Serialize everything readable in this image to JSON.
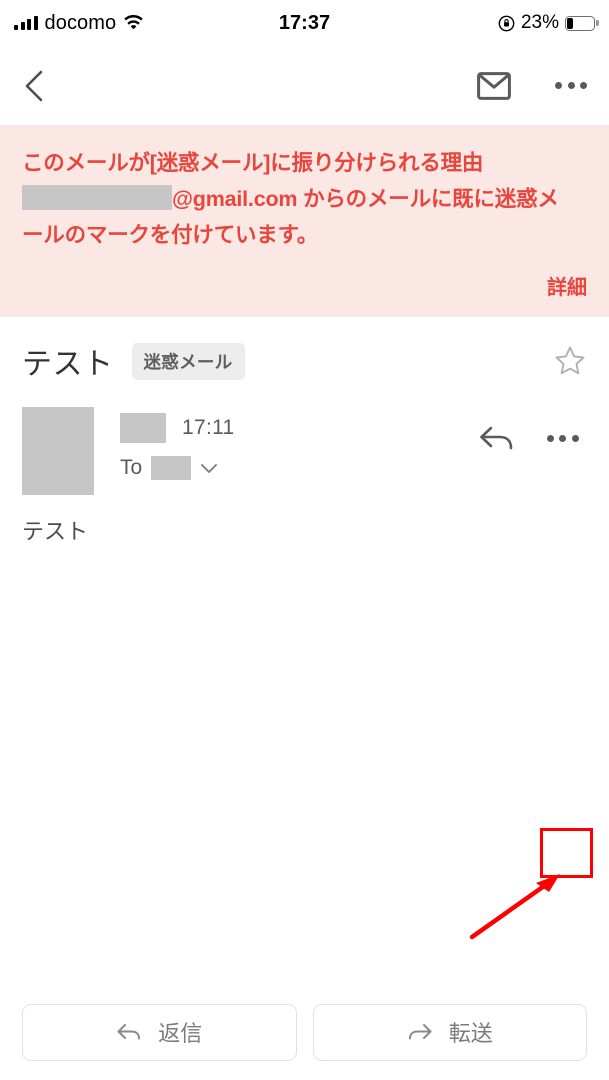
{
  "status_bar": {
    "carrier": "docomo",
    "time": "17:37",
    "battery_percent": "23%",
    "signal_icon": "signal-bars-icon",
    "wifi_icon": "wifi-icon",
    "rotation_lock_icon": "rotation-lock-icon",
    "battery_icon": "battery-icon",
    "battery_level": 23
  },
  "nav_bar": {
    "back_icon": "chevron-left-icon",
    "mail_icon": "envelope-icon",
    "more_icon": "more-horizontal-icon"
  },
  "spam_banner": {
    "title": "このメールが[迷惑メール]に振り分けられる理由",
    "body_part1": "@gmail.com からのメールに既に迷惑メ",
    "body_part2": "ールのマークを付けています。",
    "detail_link": "詳細",
    "background_color": "#FBE7E4",
    "text_color": "#E8453C",
    "redacted_sender": true
  },
  "message": {
    "subject": "テスト",
    "spam_badge": "迷惑メール",
    "star_icon": "star-outline-icon",
    "sender_name_redacted": true,
    "time": "17:11",
    "to_label": "To",
    "to_redacted": true,
    "to_expand_icon": "chevron-down-icon",
    "reply_icon": "reply-arrow-icon",
    "more_icon": "more-horizontal-icon",
    "body": "テスト",
    "avatar": "redacted-avatar"
  },
  "annotation": {
    "highlight_color": "#FF0000",
    "highlight_target": "message-more-button",
    "arrow_icon": "pointer-arrow-icon"
  },
  "bottom_bar": {
    "reply_label": "返信",
    "reply_icon": "reply-arrow-icon",
    "forward_label": "転送",
    "forward_icon": "forward-arrow-icon"
  }
}
